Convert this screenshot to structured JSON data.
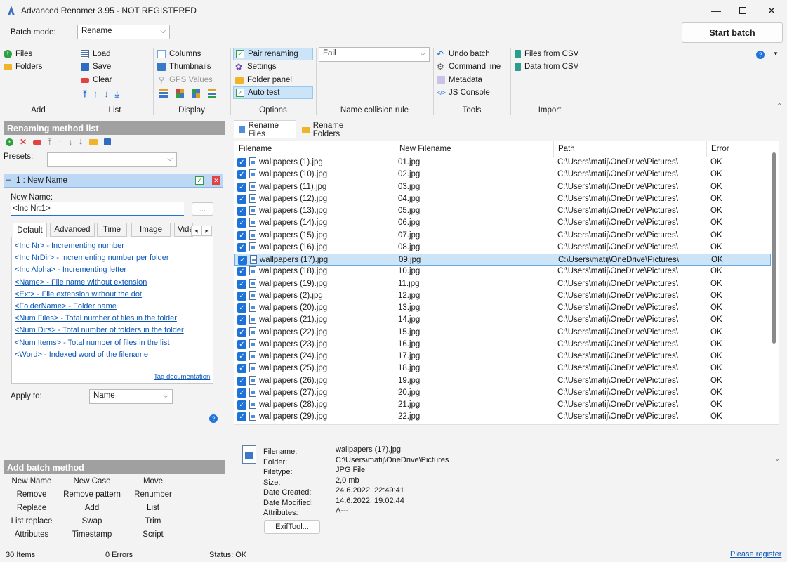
{
  "window": {
    "title": "Advanced Renamer 3.95 - NOT REGISTERED"
  },
  "toolbar": {
    "batch_mode_label": "Batch mode:",
    "batch_mode_value": "Rename",
    "start_batch": "Start batch",
    "add": {
      "files": "Files",
      "folders": "Folders",
      "label": "Add"
    },
    "list": {
      "load": "Load",
      "save": "Save",
      "clear": "Clear",
      "label": "List"
    },
    "display": {
      "columns": "Columns",
      "thumbnails": "Thumbnails",
      "gps": "GPS Values",
      "label": "Display"
    },
    "options": {
      "pair_renaming": "Pair renaming",
      "settings": "Settings",
      "folder_panel": "Folder panel",
      "auto_test": "Auto test",
      "label": "Options"
    },
    "collision": {
      "value": "Fail",
      "label": "Name collision rule"
    },
    "tools": {
      "undo_batch": "Undo batch",
      "command_line": "Command line",
      "metadata": "Metadata",
      "js_console": "JS Console",
      "label": "Tools"
    },
    "import": {
      "files_csv": "Files from CSV",
      "data_csv": "Data from CSV",
      "label": "Import"
    }
  },
  "left": {
    "method_list_header": "Renaming method list",
    "presets_label": "Presets:",
    "method_title": "1 : New Name",
    "new_name_label": "New Name:",
    "new_name_value": "<Inc Nr:1>",
    "browse": "...",
    "tabs": [
      "Default",
      "Advanced",
      "Time",
      "Image",
      "Vide"
    ],
    "tags": [
      "<Inc Nr>  - Incrementing number",
      "<Inc NrDir>  - Incrementing number per folder",
      "<Inc Alpha>  - Incrementing letter",
      "<Name>  - File name without extension",
      "<Ext>  - File extension without the dot",
      "<FolderName>  - Folder name",
      "<Num Files>  - Total number of files in the folder",
      "<Num Dirs>  - Total number of folders in the folder",
      "<Num Items>  - Total number of files in the list",
      "<Word>  - Indexed word of the filename"
    ],
    "tag_doc": "Tag documentation",
    "apply_to_label": "Apply to:",
    "apply_to_value": "Name",
    "add_batch_header": "Add batch method",
    "batch_methods": [
      [
        "New Name",
        "New Case",
        "Move"
      ],
      [
        "Remove",
        "Remove pattern",
        "Renumber"
      ],
      [
        "Replace",
        "Add",
        "List"
      ],
      [
        "List replace",
        "Swap",
        "Trim"
      ],
      [
        "Attributes",
        "Timestamp",
        "Script"
      ]
    ]
  },
  "tabs": {
    "rename_files": "Rename Files",
    "rename_folders": "Rename Folders"
  },
  "table": {
    "headers": [
      "Filename",
      "New Filename",
      "Path",
      "Error"
    ],
    "selected_index": 8,
    "rows": [
      [
        "wallpapers (1).jpg",
        "01.jpg",
        "C:\\Users\\matij\\OneDrive\\Pictures\\",
        "OK"
      ],
      [
        "wallpapers (10).jpg",
        "02.jpg",
        "C:\\Users\\matij\\OneDrive\\Pictures\\",
        "OK"
      ],
      [
        "wallpapers (11).jpg",
        "03.jpg",
        "C:\\Users\\matij\\OneDrive\\Pictures\\",
        "OK"
      ],
      [
        "wallpapers (12).jpg",
        "04.jpg",
        "C:\\Users\\matij\\OneDrive\\Pictures\\",
        "OK"
      ],
      [
        "wallpapers (13).jpg",
        "05.jpg",
        "C:\\Users\\matij\\OneDrive\\Pictures\\",
        "OK"
      ],
      [
        "wallpapers (14).jpg",
        "06.jpg",
        "C:\\Users\\matij\\OneDrive\\Pictures\\",
        "OK"
      ],
      [
        "wallpapers (15).jpg",
        "07.jpg",
        "C:\\Users\\matij\\OneDrive\\Pictures\\",
        "OK"
      ],
      [
        "wallpapers (16).jpg",
        "08.jpg",
        "C:\\Users\\matij\\OneDrive\\Pictures\\",
        "OK"
      ],
      [
        "wallpapers (17).jpg",
        "09.jpg",
        "C:\\Users\\matij\\OneDrive\\Pictures\\",
        "OK"
      ],
      [
        "wallpapers (18).jpg",
        "10.jpg",
        "C:\\Users\\matij\\OneDrive\\Pictures\\",
        "OK"
      ],
      [
        "wallpapers (19).jpg",
        "11.jpg",
        "C:\\Users\\matij\\OneDrive\\Pictures\\",
        "OK"
      ],
      [
        "wallpapers (2).jpg",
        "12.jpg",
        "C:\\Users\\matij\\OneDrive\\Pictures\\",
        "OK"
      ],
      [
        "wallpapers (20).jpg",
        "13.jpg",
        "C:\\Users\\matij\\OneDrive\\Pictures\\",
        "OK"
      ],
      [
        "wallpapers (21).jpg",
        "14.jpg",
        "C:\\Users\\matij\\OneDrive\\Pictures\\",
        "OK"
      ],
      [
        "wallpapers (22).jpg",
        "15.jpg",
        "C:\\Users\\matij\\OneDrive\\Pictures\\",
        "OK"
      ],
      [
        "wallpapers (23).jpg",
        "16.jpg",
        "C:\\Users\\matij\\OneDrive\\Pictures\\",
        "OK"
      ],
      [
        "wallpapers (24).jpg",
        "17.jpg",
        "C:\\Users\\matij\\OneDrive\\Pictures\\",
        "OK"
      ],
      [
        "wallpapers (25).jpg",
        "18.jpg",
        "C:\\Users\\matij\\OneDrive\\Pictures\\",
        "OK"
      ],
      [
        "wallpapers (26).jpg",
        "19.jpg",
        "C:\\Users\\matij\\OneDrive\\Pictures\\",
        "OK"
      ],
      [
        "wallpapers (27).jpg",
        "20.jpg",
        "C:\\Users\\matij\\OneDrive\\Pictures\\",
        "OK"
      ],
      [
        "wallpapers (28).jpg",
        "21.jpg",
        "C:\\Users\\matij\\OneDrive\\Pictures\\",
        "OK"
      ],
      [
        "wallpapers (29).jpg",
        "22.jpg",
        "C:\\Users\\matij\\OneDrive\\Pictures\\",
        "OK"
      ]
    ]
  },
  "info": {
    "labels": [
      "Filename:",
      "Folder:",
      "Filetype:",
      "Size:",
      "Date Created:",
      "Date Modified:",
      "Attributes:"
    ],
    "values": [
      "wallpapers (17).jpg",
      "C:\\Users\\matij\\OneDrive\\Pictures",
      "JPG File",
      "2,0 mb",
      "24.6.2022. 22:49:41",
      "14.6.2022. 19:02:44",
      "A---"
    ],
    "exiftool": "ExifTool..."
  },
  "status": {
    "items": "30 Items",
    "errors": "0 Errors",
    "status": "Status: OK",
    "register": "Please register"
  },
  "colors": {
    "accent": "#1e73d9",
    "link": "#0c57b6",
    "header_gray": "#a0a0a0",
    "selection": "#cce4f7"
  }
}
